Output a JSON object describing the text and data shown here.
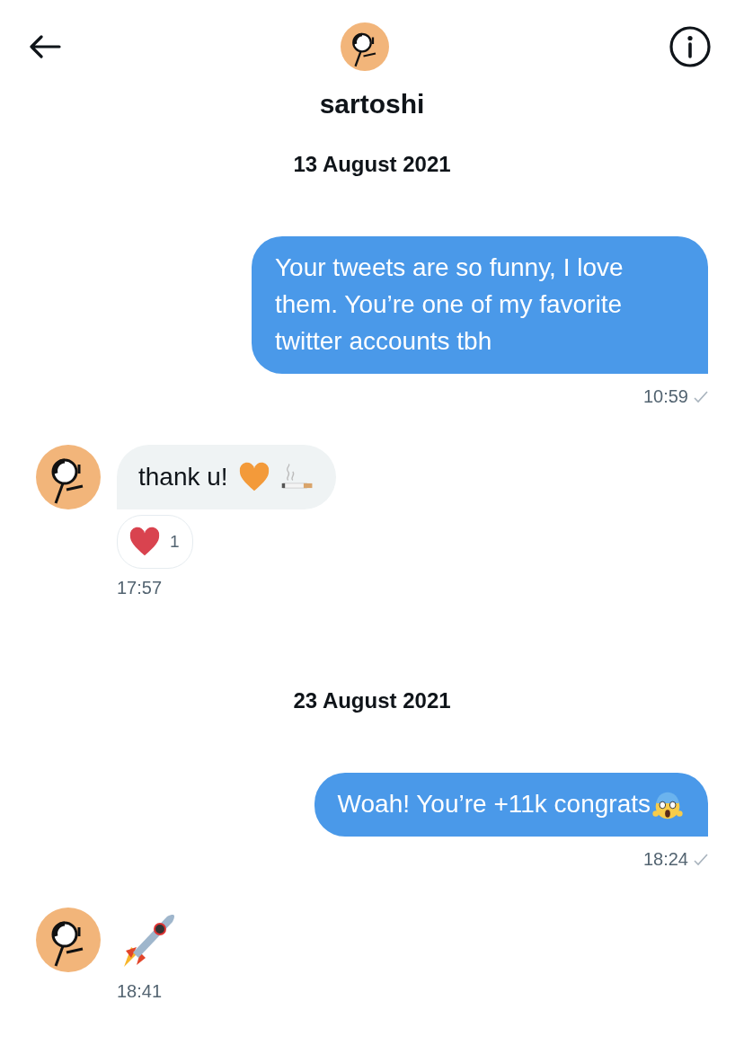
{
  "header": {
    "name": "sartoshi"
  },
  "days": [
    {
      "date": "13 August 2021",
      "messages": [
        {
          "kind": "sent",
          "text": "Your tweets are so funny, I love them. You’re one of my favorite twitter accounts tbh",
          "time": "10:59",
          "delivered": true
        },
        {
          "kind": "received",
          "text": "thank u!",
          "icons": [
            {
              "kind": "heart"
            },
            {
              "kind": "cigarette"
            }
          ],
          "reaction": {
            "count": "1"
          },
          "time": "17:57"
        }
      ]
    },
    {
      "date": "23 August 2021",
      "messages": [
        {
          "kind": "sent",
          "text": "Woah! You’re +11k congrats",
          "icons": [
            {
              "kind": "scream"
            }
          ],
          "time": "18:24",
          "delivered": true
        },
        {
          "kind": "received",
          "icons": [
            {
              "kind": "rocket"
            }
          ],
          "time": "18:41"
        }
      ]
    }
  ]
}
